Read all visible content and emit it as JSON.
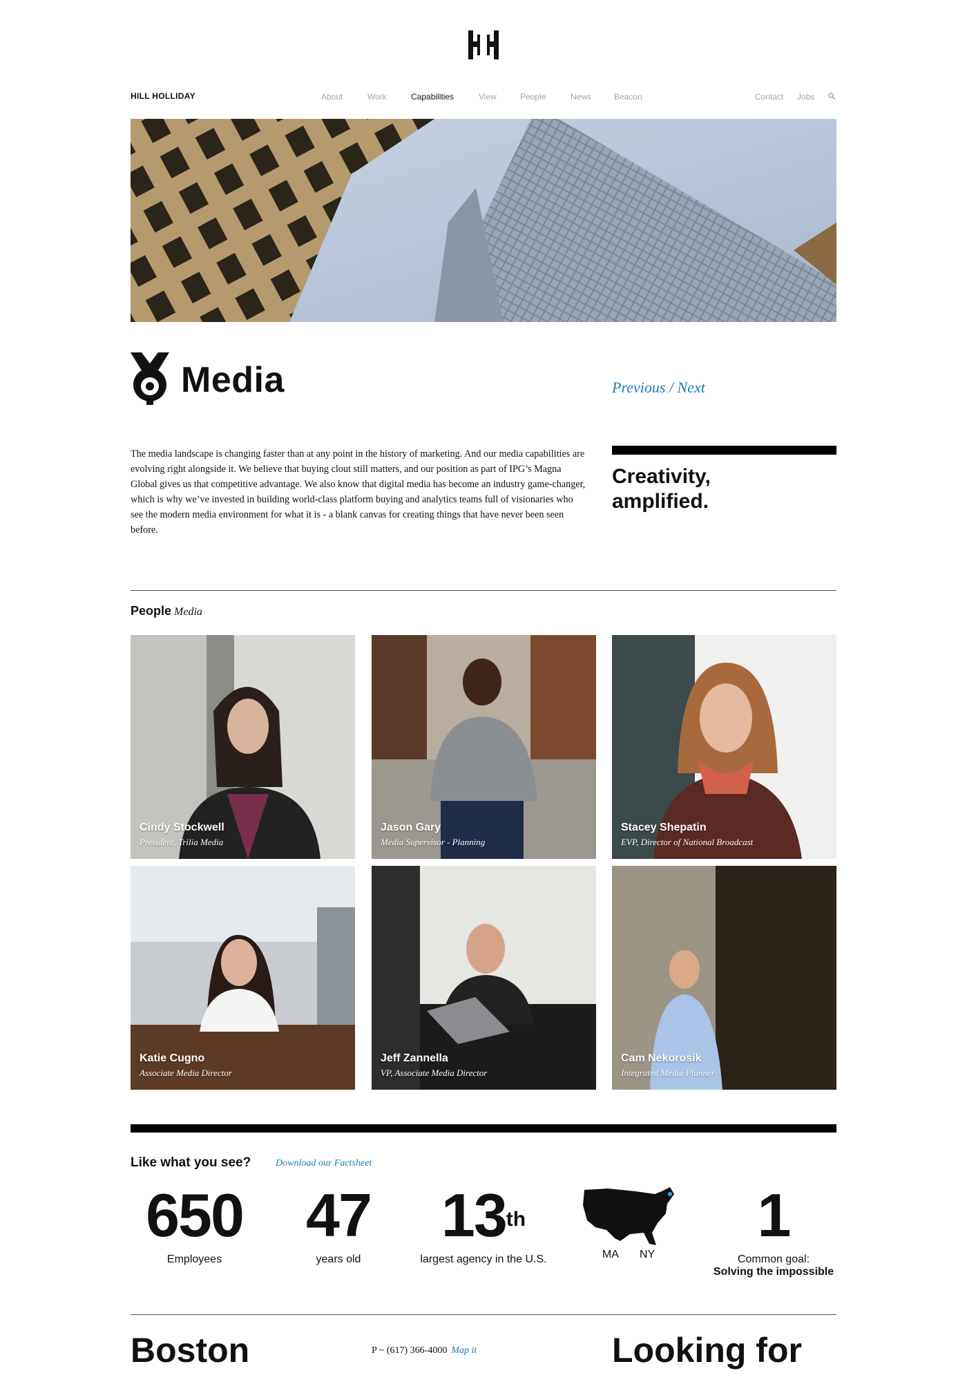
{
  "brand": "HILL HOLLIDAY",
  "nav": {
    "items": [
      "About",
      "Work",
      "Capabilities",
      "View",
      "People",
      "News",
      "Beacon"
    ],
    "active": "Capabilities",
    "right": [
      "Contact",
      "Jobs"
    ]
  },
  "page": {
    "title": "Media",
    "prev_label": "Previous",
    "separator": "/",
    "next_label": "Next",
    "intro": "The media landscape is changing faster than at any point in the history of marketing. And our media capabilities are evolving right alongside it. We believe that buying clout still matters, and our position as part of IPG’s Magna Global gives us that competitive advantage. We also know that digital media has become an industry game-changer, which is why we’ve invested in building world-class platform buying and analytics teams full of visionaries who see the modern media environment for what it is - a blank canvas for creating things that have never been seen before.",
    "quote_line1": "Creativity,",
    "quote_line2": "amplified."
  },
  "people": {
    "heading": "People",
    "subheading": "Media",
    "cards": [
      {
        "name": "Cindy Stockwell",
        "role": "President, Trilia Media"
      },
      {
        "name": "Jason Gary",
        "role": "Media Supervisor - Planning"
      },
      {
        "name": "Stacey Shepatin",
        "role": "EVP, Director of National Broadcast"
      },
      {
        "name": "Katie Cugno",
        "role": "Associate Media Director"
      },
      {
        "name": "Jeff Zannella",
        "role": "VP, Associate Media Director"
      },
      {
        "name": "Cam Nekorosik",
        "role": "Integrated Media Planner"
      }
    ]
  },
  "facts": {
    "heading": "Like what you see?",
    "download": "Download our Factsheet",
    "employees_value": "650",
    "employees_label": "Employees",
    "years_value": "47",
    "years_label": "years old",
    "rank_value": "13",
    "rank_suffix": "th",
    "rank_label": "largest agency in the U.S.",
    "map_label_1": "MA",
    "map_label_2": "NY",
    "goal_value": "1",
    "goal_label": "Common goal:",
    "goal_text": "Solving the impossible"
  },
  "footer": {
    "city": "Boston",
    "phone": "P ~ (617) 366-4000",
    "map_link": "Map it",
    "looking": "Looking for"
  },
  "colors": {
    "accent": "#1c7ab5",
    "text": "#111111",
    "nav_inactive": "#a4a4a4"
  }
}
